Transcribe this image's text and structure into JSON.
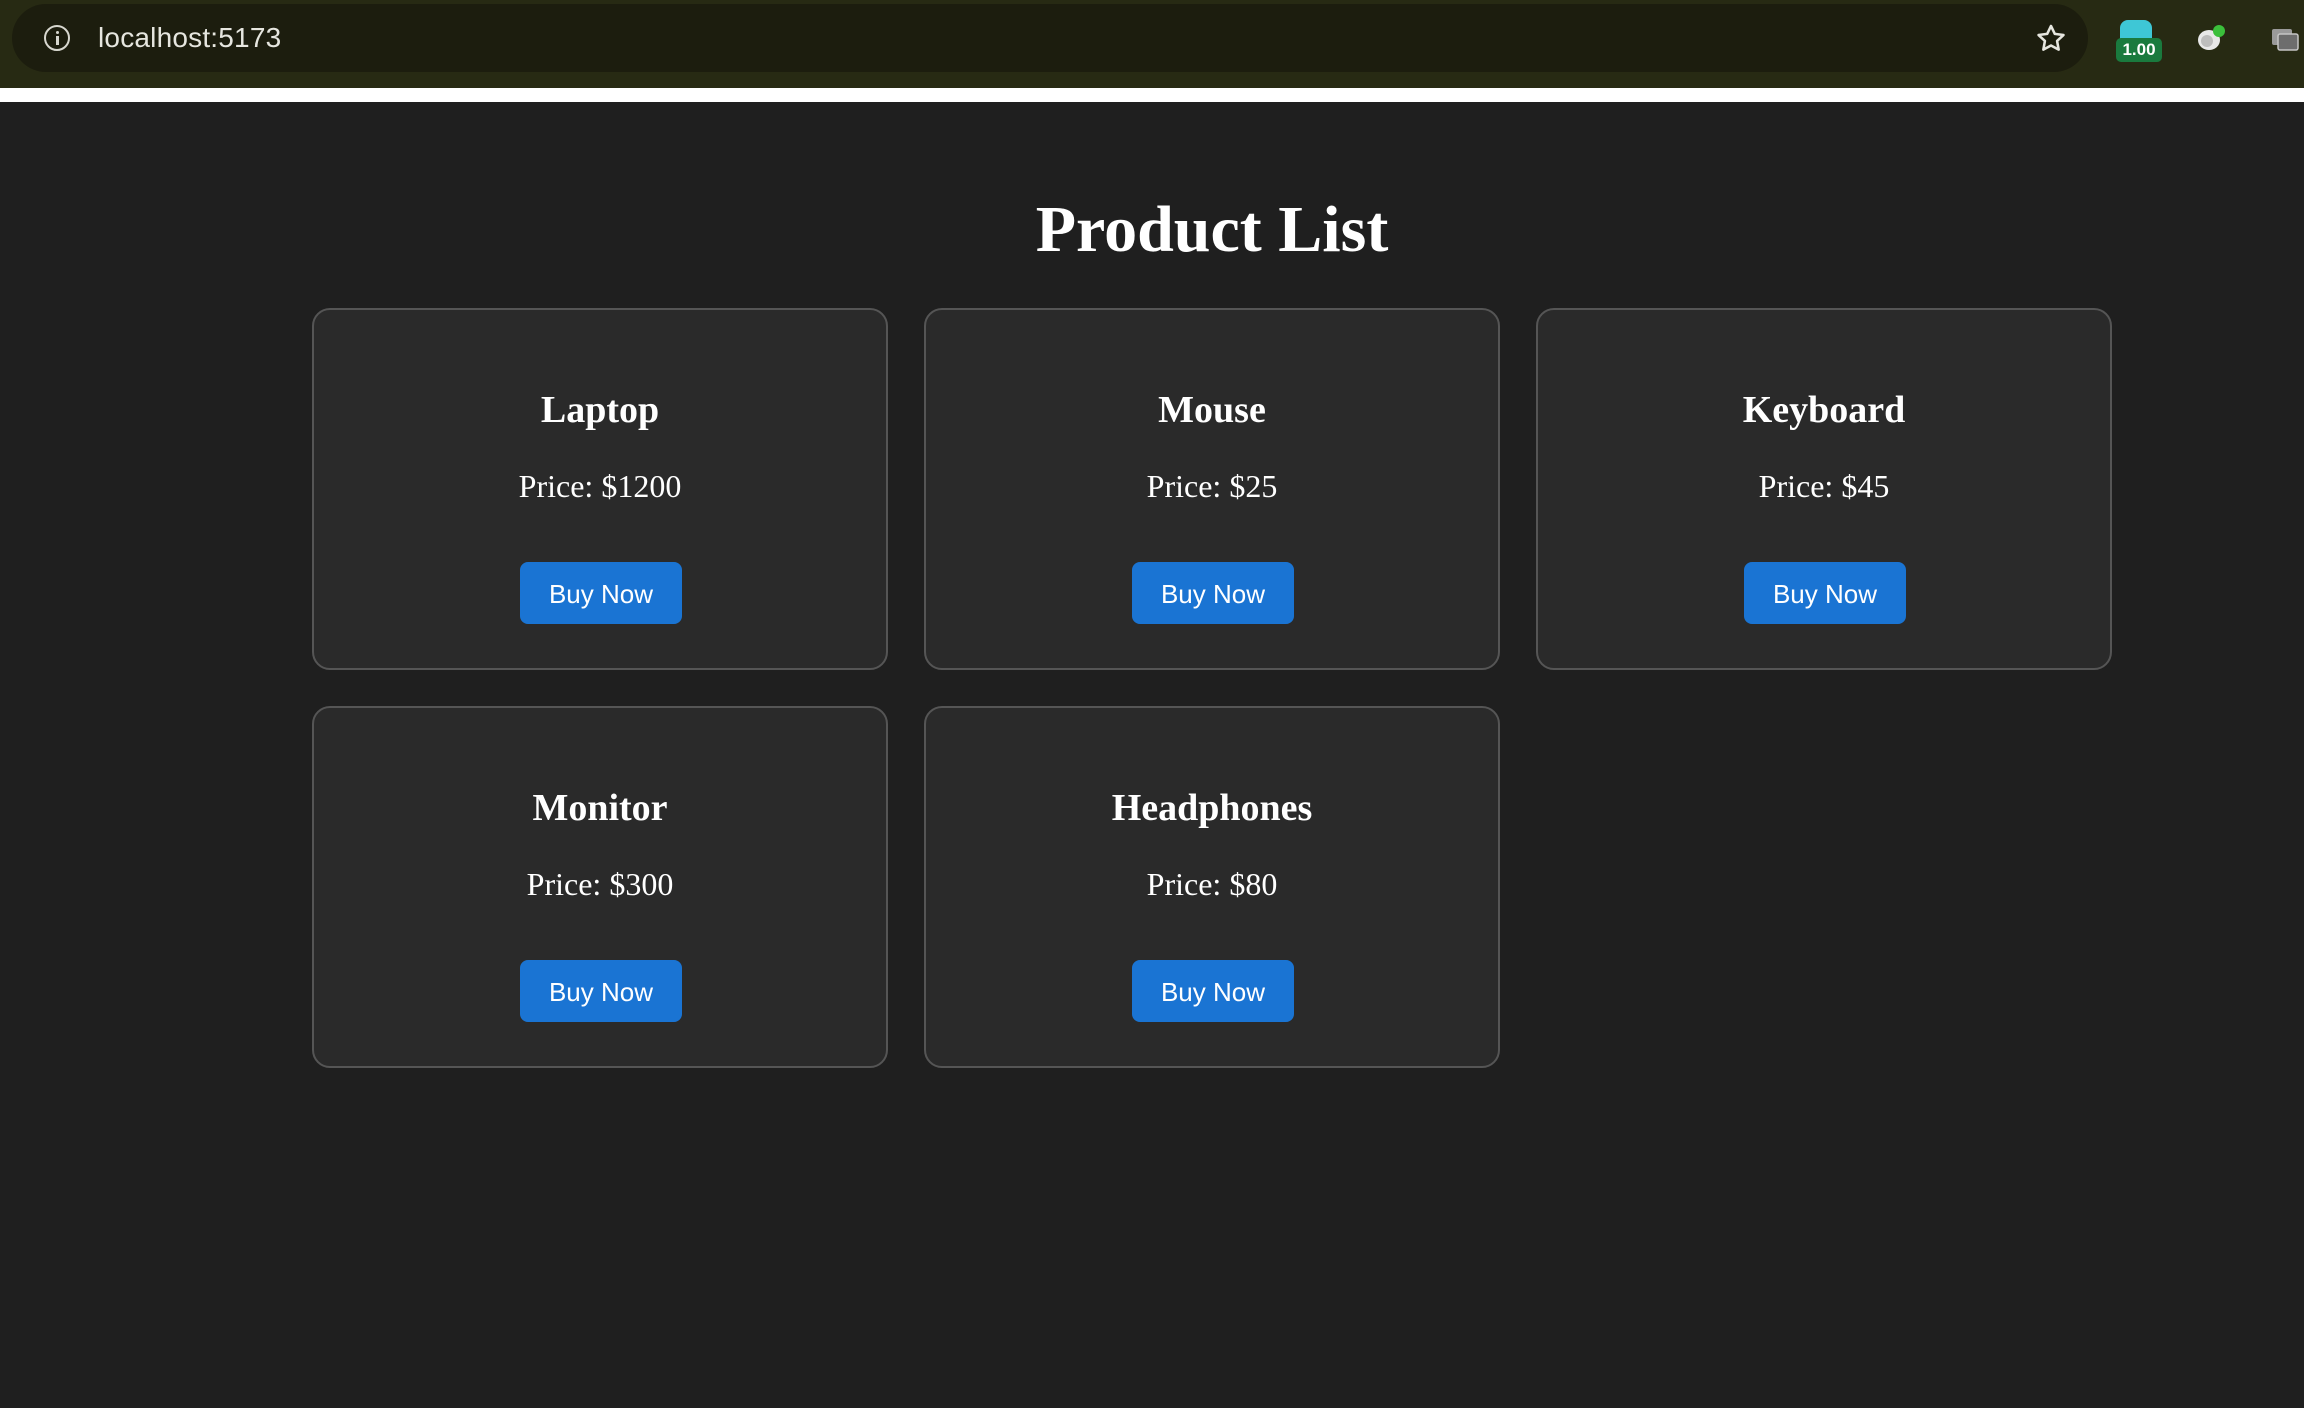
{
  "browser": {
    "url": "localhost:5173",
    "extension_badge": "1.00"
  },
  "page": {
    "title": "Product List"
  },
  "products": [
    {
      "name": "Laptop",
      "price": "Price: $1200",
      "button": "Buy Now"
    },
    {
      "name": "Mouse",
      "price": "Price: $25",
      "button": "Buy Now"
    },
    {
      "name": "Keyboard",
      "price": "Price: $45",
      "button": "Buy Now"
    },
    {
      "name": "Monitor",
      "price": "Price: $300",
      "button": "Buy Now"
    },
    {
      "name": "Headphones",
      "price": "Price: $80",
      "button": "Buy Now"
    }
  ],
  "colors": {
    "background": "#1f1f1f",
    "card": "#2a2a2a",
    "card_border": "#555555",
    "button": "#1a74d3",
    "text": "#ffffff"
  },
  "icons": [
    "info-icon",
    "star-icon",
    "extension-icon",
    "extension-icon",
    "extension-icon"
  ]
}
